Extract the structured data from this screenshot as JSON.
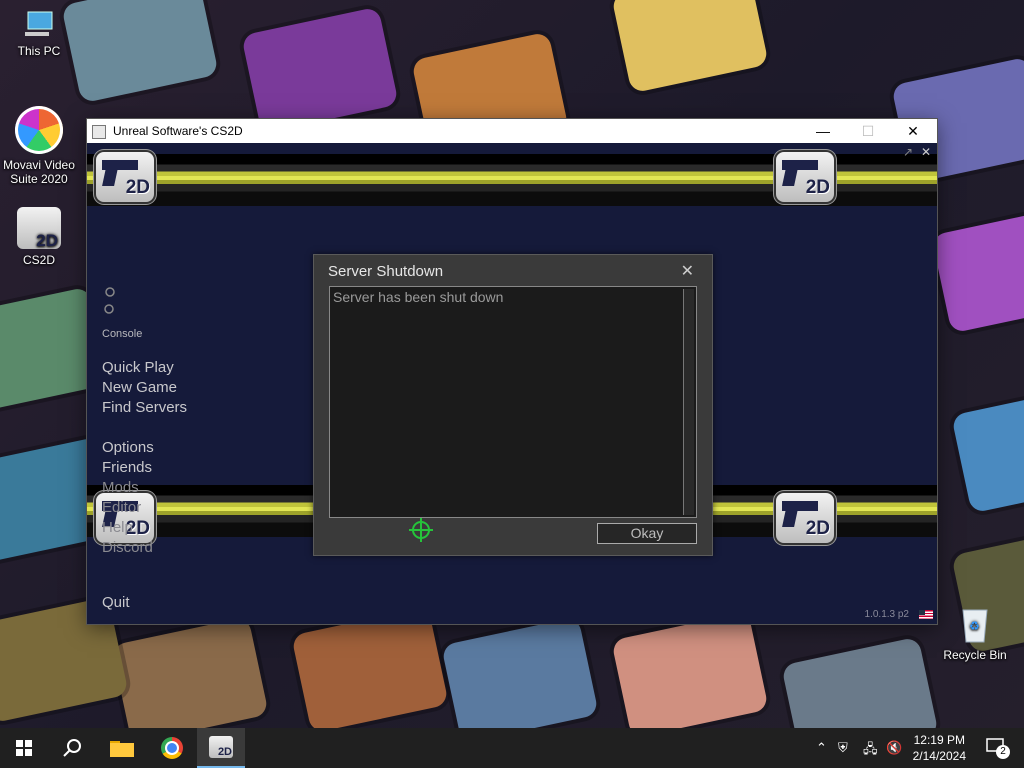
{
  "desktop": {
    "icons": [
      {
        "label": "This PC"
      },
      {
        "label": "Movavi Video Suite 2020"
      },
      {
        "label": "CS2D"
      },
      {
        "label": "Recycle Bin"
      }
    ]
  },
  "window": {
    "title": "Unreal Software's CS2D",
    "controls": {
      "minimize": "—",
      "maximize": "☐",
      "close": "✕"
    }
  },
  "game": {
    "logo_text": "2D",
    "menu_small": "Console",
    "menu": [
      "Quick Play",
      "New Game",
      "Find Servers",
      "Options",
      "Friends",
      "Mods",
      "Editor",
      "Help",
      "Discord",
      "Quit"
    ],
    "version": "1.0.1.3 p2",
    "corner_icons": {
      "expand": "↗",
      "close": "✕"
    }
  },
  "dialog": {
    "title": "Server Shutdown",
    "close": "✕",
    "message": "Server has been shut down",
    "ok_label": "Okay"
  },
  "taskbar": {
    "time": "12:19 PM",
    "date": "2/14/2024",
    "notifications": "2"
  },
  "colors": {
    "game_bg": "#151a3a",
    "band_yellow": "#e2e654",
    "crosshair": "#25c43a",
    "taskbar": "#202020"
  }
}
